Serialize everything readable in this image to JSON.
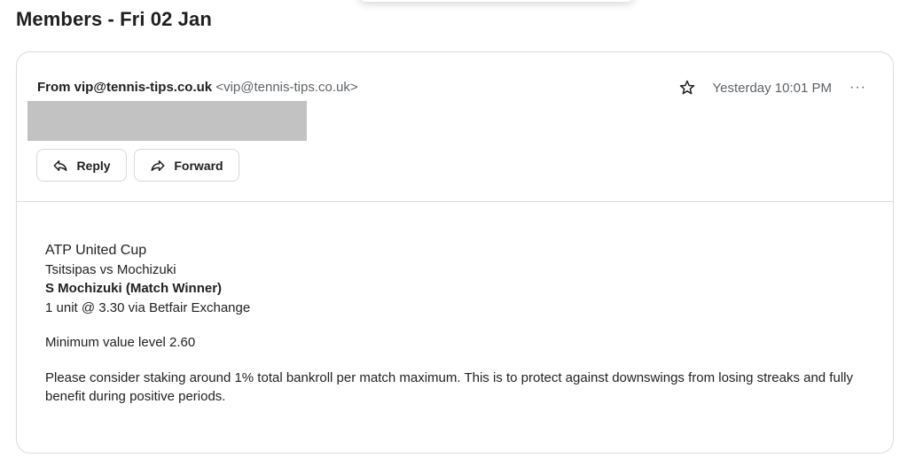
{
  "page": {
    "title": "Members - Fri 02 Jan"
  },
  "email": {
    "from_label": "From vip@tennis-tips.co.uk",
    "from_address": "<vip@tennis-tips.co.uk>",
    "timestamp": "Yesterday 10:01 PM",
    "more_label": "···",
    "actions": {
      "reply": "Reply",
      "forward": "Forward"
    },
    "body": {
      "line1": "ATP United Cup",
      "line2": "Tsitsipas vs Mochizuki",
      "line3": "S Mochizuki (Match Winner)",
      "line4": "1 unit @ 3.30 via Betfair Exchange",
      "line5": "Minimum value level 2.60",
      "line6": "Please consider staking around 1% total bankroll per match maximum. This is to protect against downswings from losing streaks and fully benefit during positive periods."
    }
  },
  "icons": {
    "star": "star-icon",
    "reply": "reply-icon",
    "forward": "forward-icon",
    "more": "more-icon"
  }
}
